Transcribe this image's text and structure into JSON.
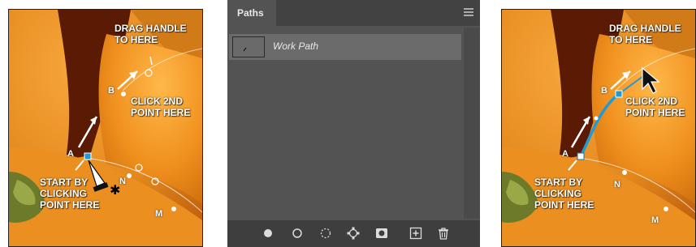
{
  "left_image": {
    "labels": {
      "drag_handle": "DRAG HANDLE\nTO HERE",
      "click_2nd": "CLICK 2ND\nPOINT HERE",
      "start_by": "START BY\nCLICKING\nPOINT HERE"
    },
    "points": {
      "a": "A",
      "b": "B",
      "n": "N",
      "m": "M"
    }
  },
  "panel": {
    "tab_label": "Paths",
    "menu_icon": "panel-menu-icon",
    "path_name": "Work Path",
    "bottom_tools": [
      "fill-path-icon",
      "stroke-path-icon",
      "load-selection-icon",
      "make-work-path-icon",
      "add-mask-icon",
      "new-path-icon",
      "trash-icon"
    ]
  },
  "right_image": {
    "labels": {
      "drag_handle": "DRAG HANDLE\nTO HERE",
      "click_2nd": "CLICK 2ND\nPOINT HERE",
      "start_by": "START BY\nCLICKING\nPOINT HERE"
    },
    "points": {
      "a": "A",
      "b": "B",
      "n": "N",
      "m": "M"
    }
  },
  "colors": {
    "orange": "#e4891e",
    "dark_orange": "#8a3a08",
    "path_blue": "#1e9bd7",
    "panel_bg": "#535353",
    "panel_dark": "#3e3e3e"
  }
}
